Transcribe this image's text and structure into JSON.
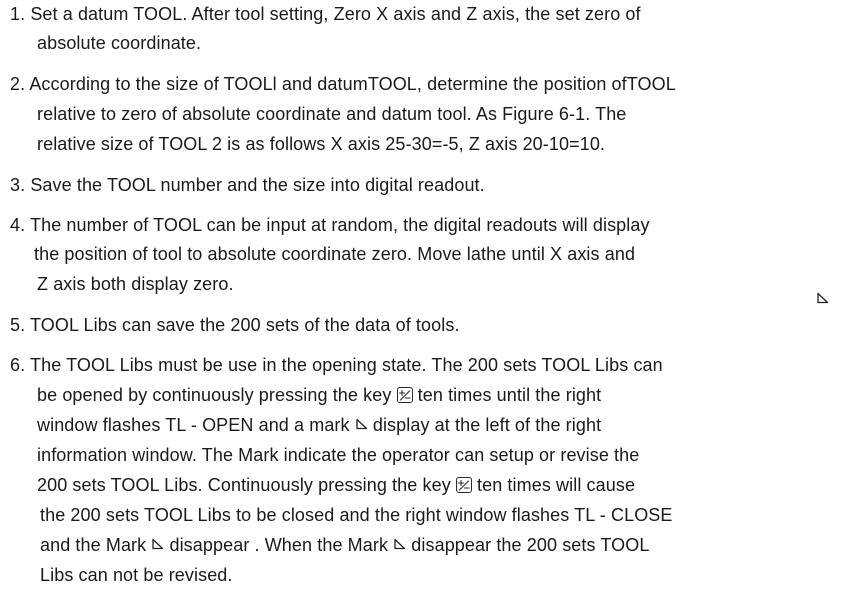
{
  "items": [
    {
      "lines": [
        "1. Set a datum TOOL. After tool setting, Zero X axis and Z axis, the set zero of",
        "absolute coordinate."
      ]
    },
    {
      "lines": [
        "2. According to the size of TOOLl and datumTOOL, determine the position ofTOOL",
        "relative  to zero of absolute coordinate and datum tool. As Figure 6-1.  The",
        "relative size of  TOOL 2 is as follows X axis 25-30=-5, Z axis 20-10=10."
      ]
    },
    {
      "lines": [
        "3. Save the TOOL number and the  size into digital readout."
      ]
    },
    {
      "lines": [
        "4. The number of TOOL can be input at random, the digital readouts will display",
        "the position of tool to absolute coordinate zero. Move lathe until X axis and",
        "Z axis both display zero."
      ]
    },
    {
      "lines": [
        "5. TOOL Libs can save the 200 sets of  the data of tools."
      ]
    },
    {
      "lines": [
        "6. The TOOL Libs must be use in the opening  state. The 200 sets TOOL  Libs can",
        {
          "before": "be opened  by continuously pressing the key ",
          "icon": "plus-minus-key-icon",
          "after": " ten times until the  right"
        },
        {
          "before": "window flashes  TL - OPEN  and  a mark ",
          "icon": "mark-icon",
          "after": " display at the left of the right"
        },
        "information window.  The Mark indicate the operator can setup or revise the",
        {
          "before": "200 sets TOOL Libs. Continuously pressing the key ",
          "icon": "plus-minus-key-icon",
          "after": " ten times will cause"
        },
        "the 200 sets TOOL Libs to be closed and the right window flashes TL - CLOSE",
        {
          "before": "and the Mark ",
          "icon": "mark-icon",
          "after": " disappear .  When the Mark ",
          "icon2": "mark-icon",
          "after2": " disappear the 200 sets TOOL"
        },
        "Libs can not be revised."
      ]
    }
  ]
}
